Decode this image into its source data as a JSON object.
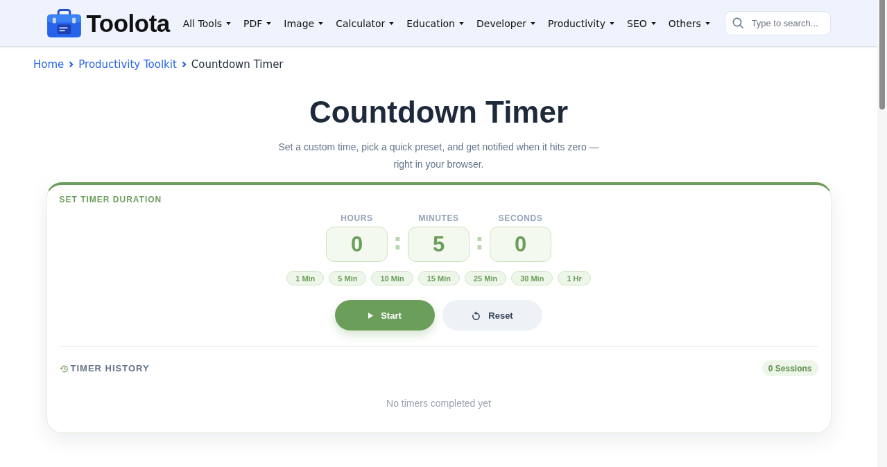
{
  "header": {
    "logo_text": "Toolota",
    "nav": [
      "All Tools",
      "PDF",
      "Image",
      "Calculator",
      "Education",
      "Developer",
      "Productivity",
      "SEO",
      "Others"
    ],
    "search": {
      "placeholder": "Type to search..."
    }
  },
  "breadcrumb": [
    {
      "label": "Home",
      "kind": "link"
    },
    {
      "label": "Productivity Toolkit",
      "kind": "link"
    },
    {
      "label": "Countdown Timer",
      "kind": "current"
    }
  ],
  "title": "Countdown Timer",
  "subtitle": "Set a custom time, pick a quick preset, and get notified when it hits zero — right in your browser.",
  "timer_card": {
    "heading": "SET TIMER DURATION",
    "fields": [
      {
        "label": "HOURS",
        "value": "0"
      },
      {
        "label": "MINUTES",
        "value": "5"
      },
      {
        "label": "SECONDS",
        "value": "0"
      }
    ],
    "separators": [
      ":",
      ":"
    ],
    "presets": [
      "1 Min",
      "5 Min",
      "10 Min",
      "15 Min",
      "25 Min",
      "30 Min",
      "1 Hr"
    ],
    "buttons": [
      {
        "label": "Start",
        "kind": "primary"
      },
      {
        "label": "Reset",
        "kind": "secondary"
      }
    ]
  },
  "history": {
    "heading": "TIMER HISTORY",
    "count": "0 Sessions",
    "empty_message": "No timers completed yet"
  }
}
